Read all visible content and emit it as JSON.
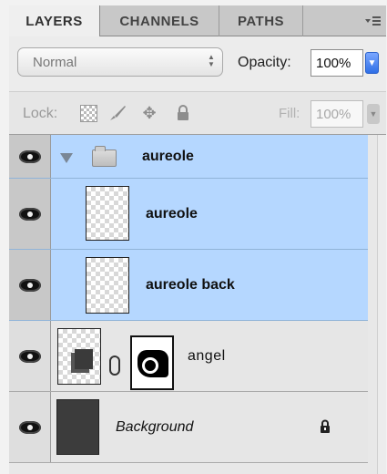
{
  "tabs": [
    {
      "label": "LAYERS",
      "active": true
    },
    {
      "label": "CHANNELS",
      "active": false
    },
    {
      "label": "PATHS",
      "active": false
    }
  ],
  "panel_menu_icon": "panel-menu-icon",
  "blend": {
    "mode": "Normal",
    "opacity_label": "Opacity:",
    "opacity_value": "100%"
  },
  "lock": {
    "label": "Lock:",
    "icons": [
      "lock-transparent-icon",
      "brush-icon",
      "move-icon",
      "padlock-icon"
    ],
    "fill_label": "Fill:",
    "fill_value": "100%"
  },
  "layers": [
    {
      "name": "aureole",
      "type": "group",
      "selected": true,
      "visible": true
    },
    {
      "name": "aureole",
      "type": "layer",
      "selected": true,
      "visible": true
    },
    {
      "name": "aureole back",
      "type": "layer",
      "selected": true,
      "visible": true
    },
    {
      "name": "angel",
      "type": "layer-with-mask",
      "selected": false,
      "visible": true
    },
    {
      "name": "Background",
      "type": "background",
      "selected": false,
      "visible": true,
      "locked": true
    }
  ],
  "colors": {
    "selection": "#b5d7ff",
    "accent": "#2f6fe6"
  }
}
